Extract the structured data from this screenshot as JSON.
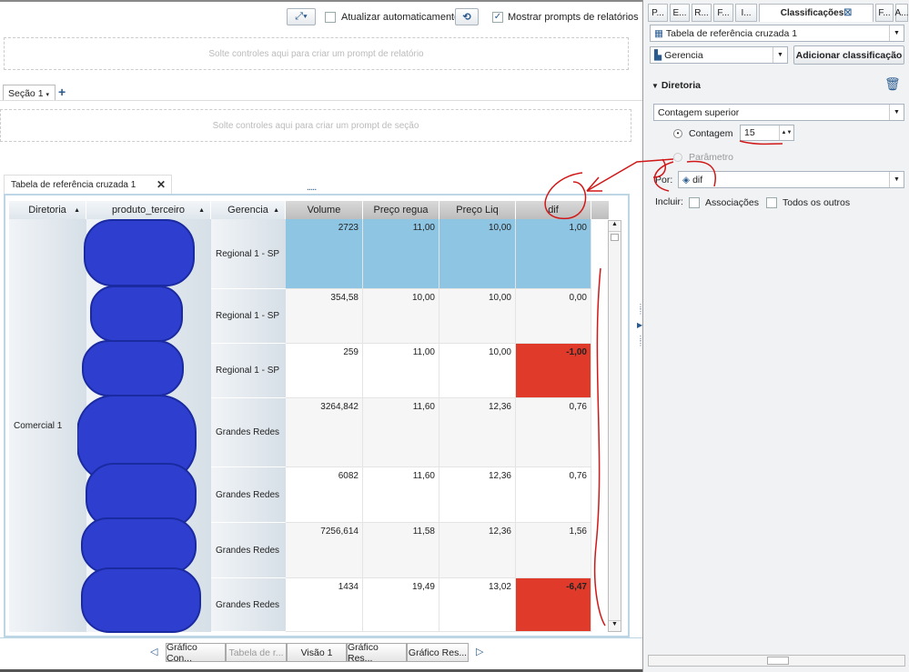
{
  "toolbar": {
    "auto_update_label": "Atualizar automaticamente",
    "auto_update_checked": false,
    "show_prompts_label": "Mostrar prompts de relatórios",
    "show_prompts_checked": true
  },
  "report_prompt_placeholder": "Solte controles aqui para criar um prompt de relatório",
  "section_tab": "Seção 1",
  "add_section": "+",
  "section_prompt_placeholder": "Solte controles aqui para criar um prompt de seção",
  "object_tab": {
    "title": "Tabela de referência cruzada 1",
    "close": "✕"
  },
  "table": {
    "headers": [
      "Diretoria",
      "produto_terceiro",
      "Gerencia",
      "Volume",
      "Preço regua",
      "Preço Liq",
      "dif"
    ],
    "diretoria": "Comercial 1",
    "rows": [
      {
        "gerencia": "Regional 1 - SP",
        "volume": "2723",
        "preco_regua": "11,00",
        "preco_liq": "10,00",
        "dif": "1,00"
      },
      {
        "gerencia": "Regional 1 - SP",
        "volume": "354,58",
        "preco_regua": "10,00",
        "preco_liq": "10,00",
        "dif": "0,00"
      },
      {
        "gerencia": "Regional 1 - SP",
        "volume": "259",
        "preco_regua": "11,00",
        "preco_liq": "10,00",
        "dif": "-1,00"
      },
      {
        "gerencia": "Grandes Redes",
        "volume": "3264,842",
        "preco_regua": "11,60",
        "preco_liq": "12,36",
        "dif": "0,76"
      },
      {
        "gerencia": "Grandes Redes",
        "volume": "6082",
        "preco_regua": "11,60",
        "preco_liq": "12,36",
        "dif": "0,76"
      },
      {
        "gerencia": "Grandes Redes",
        "volume": "7256,614",
        "preco_regua": "11,58",
        "preco_liq": "12,36",
        "dif": "1,56"
      },
      {
        "gerencia": "Grandes Redes",
        "volume": "1434",
        "preco_regua": "19,49",
        "preco_liq": "13,02",
        "dif": "-6,47"
      }
    ],
    "colors": {
      "selected": "#8ec5e3",
      "negative": "#e03a2a"
    }
  },
  "bottom_tabs": [
    "Gráfico Con...",
    "Tabela de r...",
    "Visão 1",
    "Gráfico Res...",
    "Gráfico Res..."
  ],
  "panel": {
    "tabs": [
      "P...",
      "E...",
      "R...",
      "F...",
      "I...",
      "Classificações",
      "F...",
      "A..."
    ],
    "object_select": "Tabela de referência cruzada 1",
    "category_select": "Gerencia",
    "add_button": "Adicionar classificação",
    "section_title": "Diretoria",
    "rank_type": "Contagem superior",
    "count_label": "Contagem",
    "count_value": "15",
    "param_label": "Parâmetro",
    "by_label": "Por:",
    "by_value": "dif",
    "include_label": "Incluir:",
    "assoc_label": "Associações",
    "others_label": "Todos os outros"
  }
}
